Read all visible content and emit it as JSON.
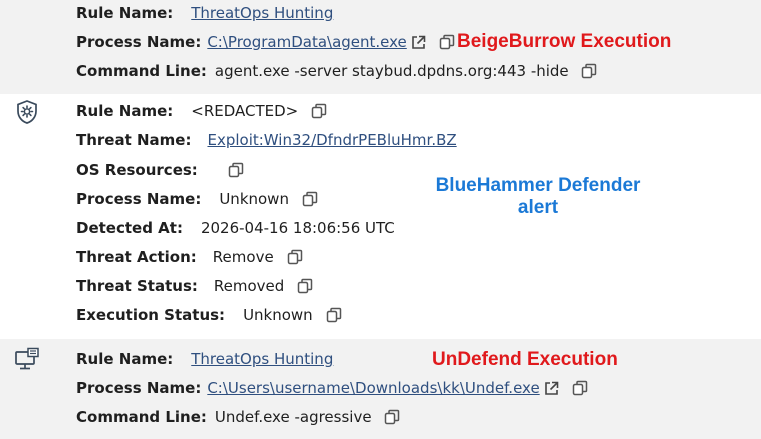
{
  "colors": {
    "section_bg_alt": "#f2f2f2",
    "link": "#2f4f7f",
    "annotation_red": "#e0191c",
    "annotation_blue": "#1b79d6"
  },
  "section1": {
    "icon": "none",
    "rows": [
      {
        "label": "Rule Name:",
        "value": "ThreatOps Hunting"
      },
      {
        "label": "Process Name:",
        "value": "C:\\ProgramData\\agent.exe"
      },
      {
        "label": "Command Line:",
        "value": "agent.exe -server staybud.dpdns.org:443 -hide"
      }
    ],
    "annotation": "BeigeBurrow Execution"
  },
  "section2": {
    "icon": "shield-gear-icon",
    "rows": [
      {
        "label": "Rule Name:",
        "value": "<REDACTED>"
      },
      {
        "label": "Threat Name:",
        "value": "Exploit:Win32/DfndrPEBluHmr.BZ"
      },
      {
        "label": "OS Resources:",
        "value": ""
      },
      {
        "label": "Process Name:",
        "value": "Unknown"
      },
      {
        "label": "Detected At:",
        "value": "2026-04-16 18:06:56 UTC"
      },
      {
        "label": "Threat Action:",
        "value": "Remove"
      },
      {
        "label": "Threat Status:",
        "value": "Removed"
      },
      {
        "label": "Execution Status:",
        "value": "Unknown"
      }
    ],
    "annotation_line1": "BlueHammer Defender",
    "annotation_line2": "alert"
  },
  "section3": {
    "icon": "computer-process-icon",
    "rows": [
      {
        "label": "Rule Name:",
        "value": "ThreatOps Hunting"
      },
      {
        "label": "Process Name:",
        "value": "C:\\Users\\username\\Downloads\\kk\\Undef.exe"
      },
      {
        "label": "Command Line:",
        "value": "Undef.exe -agressive"
      }
    ],
    "annotation": "UnDefend Execution"
  }
}
